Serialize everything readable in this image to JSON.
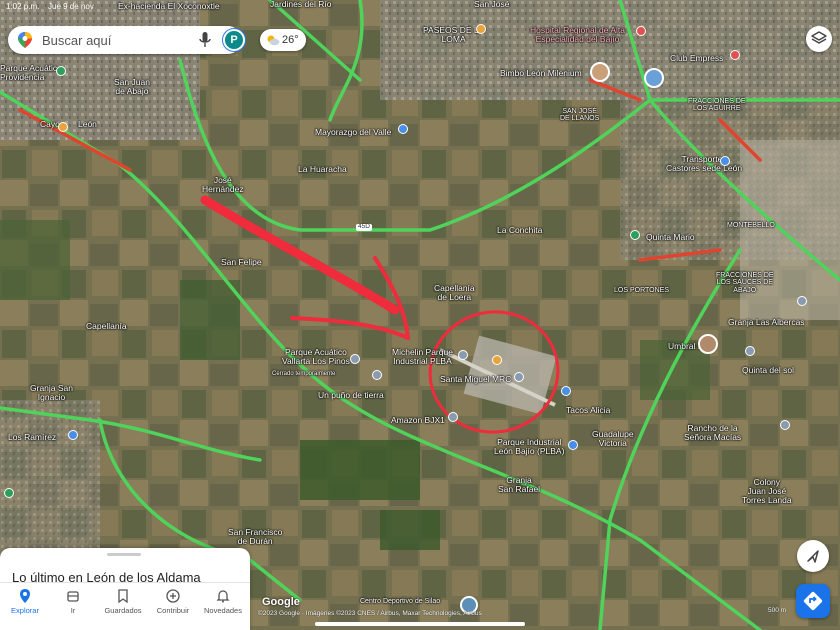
{
  "status_bar": {
    "time": "1:02 p.m.",
    "date": "Jue 9 de nov"
  },
  "search": {
    "placeholder": "Buscar aquí",
    "avatar_letter": "P"
  },
  "weather": {
    "temperature": "26°",
    "icon": "partly-cloudy-icon"
  },
  "map_labels": {
    "exhacienda": "Ex-hacienda El Xoconoxtle",
    "jardines": "Jardines del Río",
    "sanjose": "San José",
    "paseos": "PASEOS DE LA\nLOMA",
    "hospital": "Hospital Regional de Alta\nEspecialidad del Bajío",
    "club_empress": "Club Empress",
    "bimbo": "Bimbo León Milenium",
    "providencia": "Parque Acuático\nProvidencia",
    "san_juan": "San Juan\nde Abajo",
    "cayo": "Cayo",
    "leon": "León",
    "fracc_aguirre": "FRACCIONES DE\nLOS AGUIRRE",
    "san_jose_llanos": "SAN JOSÉ\nDE LLANOS",
    "mayorazgo": "Mayorazgo del Valle",
    "la_huaracha": "La Huaracha",
    "transportes": "Transportes\nCastores sede León",
    "jose_hernandez": "José\nHernández",
    "la_conchita": "La Conchita",
    "quinta_mario": "Quinta Mario",
    "montebello": "MONTEBELLO",
    "san_felipe": "San Felipe",
    "fracc_sauces": "FRACCIONES DE\nLOS SAUCES DE\nABAJO",
    "capellania_loera": "Capellanía\nde Loera",
    "los_portones": "LOS PORTONES",
    "granja_albercas": "Granja Las Albercas",
    "capellania": "Capellanía",
    "parque_acuatico": "Parque Acuático\nVallarta Los Pinos",
    "cerrado_temp": "Cerrado temporalmente",
    "michelin": "Michelin Parque\nIndustrial PLBA",
    "umbral": "Umbral León",
    "quinta_sol": "Quinta del sol",
    "granja_san_ignacio": "Granja San\nIgnacio",
    "un_punio": "Un puño de tierra",
    "santa_miguel": "Santa Miguel MRC",
    "tacos": "Tacos Alicia",
    "los_ramirez": "Los Ramírez",
    "amazon": "Amazon BJX1",
    "parque_industrial": "Parque Industrial\nLeón Bajío (PLBA)",
    "guadalupe": "Guadalupe\nVictoria",
    "rancho_senora": "Rancho de la\nSeñora Macías",
    "granja_san_rafael": "Granja\nSan Rafael",
    "colony": "Colony\nJuan José\nTorres Landa",
    "san_francisco": "San Francisco\nde Durán",
    "centro_deportivo": "Centro Deportivo de Silao",
    "road_45d": "45D"
  },
  "bottom_sheet": {
    "title": "Lo último en León de los Aldama"
  },
  "nav": [
    {
      "label": "Explorar",
      "icon": "pin-icon",
      "active": true
    },
    {
      "label": "Ir",
      "icon": "car-icon",
      "active": false
    },
    {
      "label": "Guardados",
      "icon": "bookmark-icon",
      "active": false
    },
    {
      "label": "Contribuir",
      "icon": "plus-circle-icon",
      "active": false
    },
    {
      "label": "Novedades",
      "icon": "bell-icon",
      "active": false
    }
  ],
  "attribution": {
    "logo": "Google",
    "copyright": "©2023 Google · Imágenes ©2023 CNES / Airbus, Maxar Technologies, Airbus",
    "scale": "500 m"
  },
  "colors": {
    "accent": "#1a73e8",
    "traffic_green": "#4fd35a",
    "traffic_red": "#e0442e",
    "annotation_red": "#ef2b3c"
  }
}
